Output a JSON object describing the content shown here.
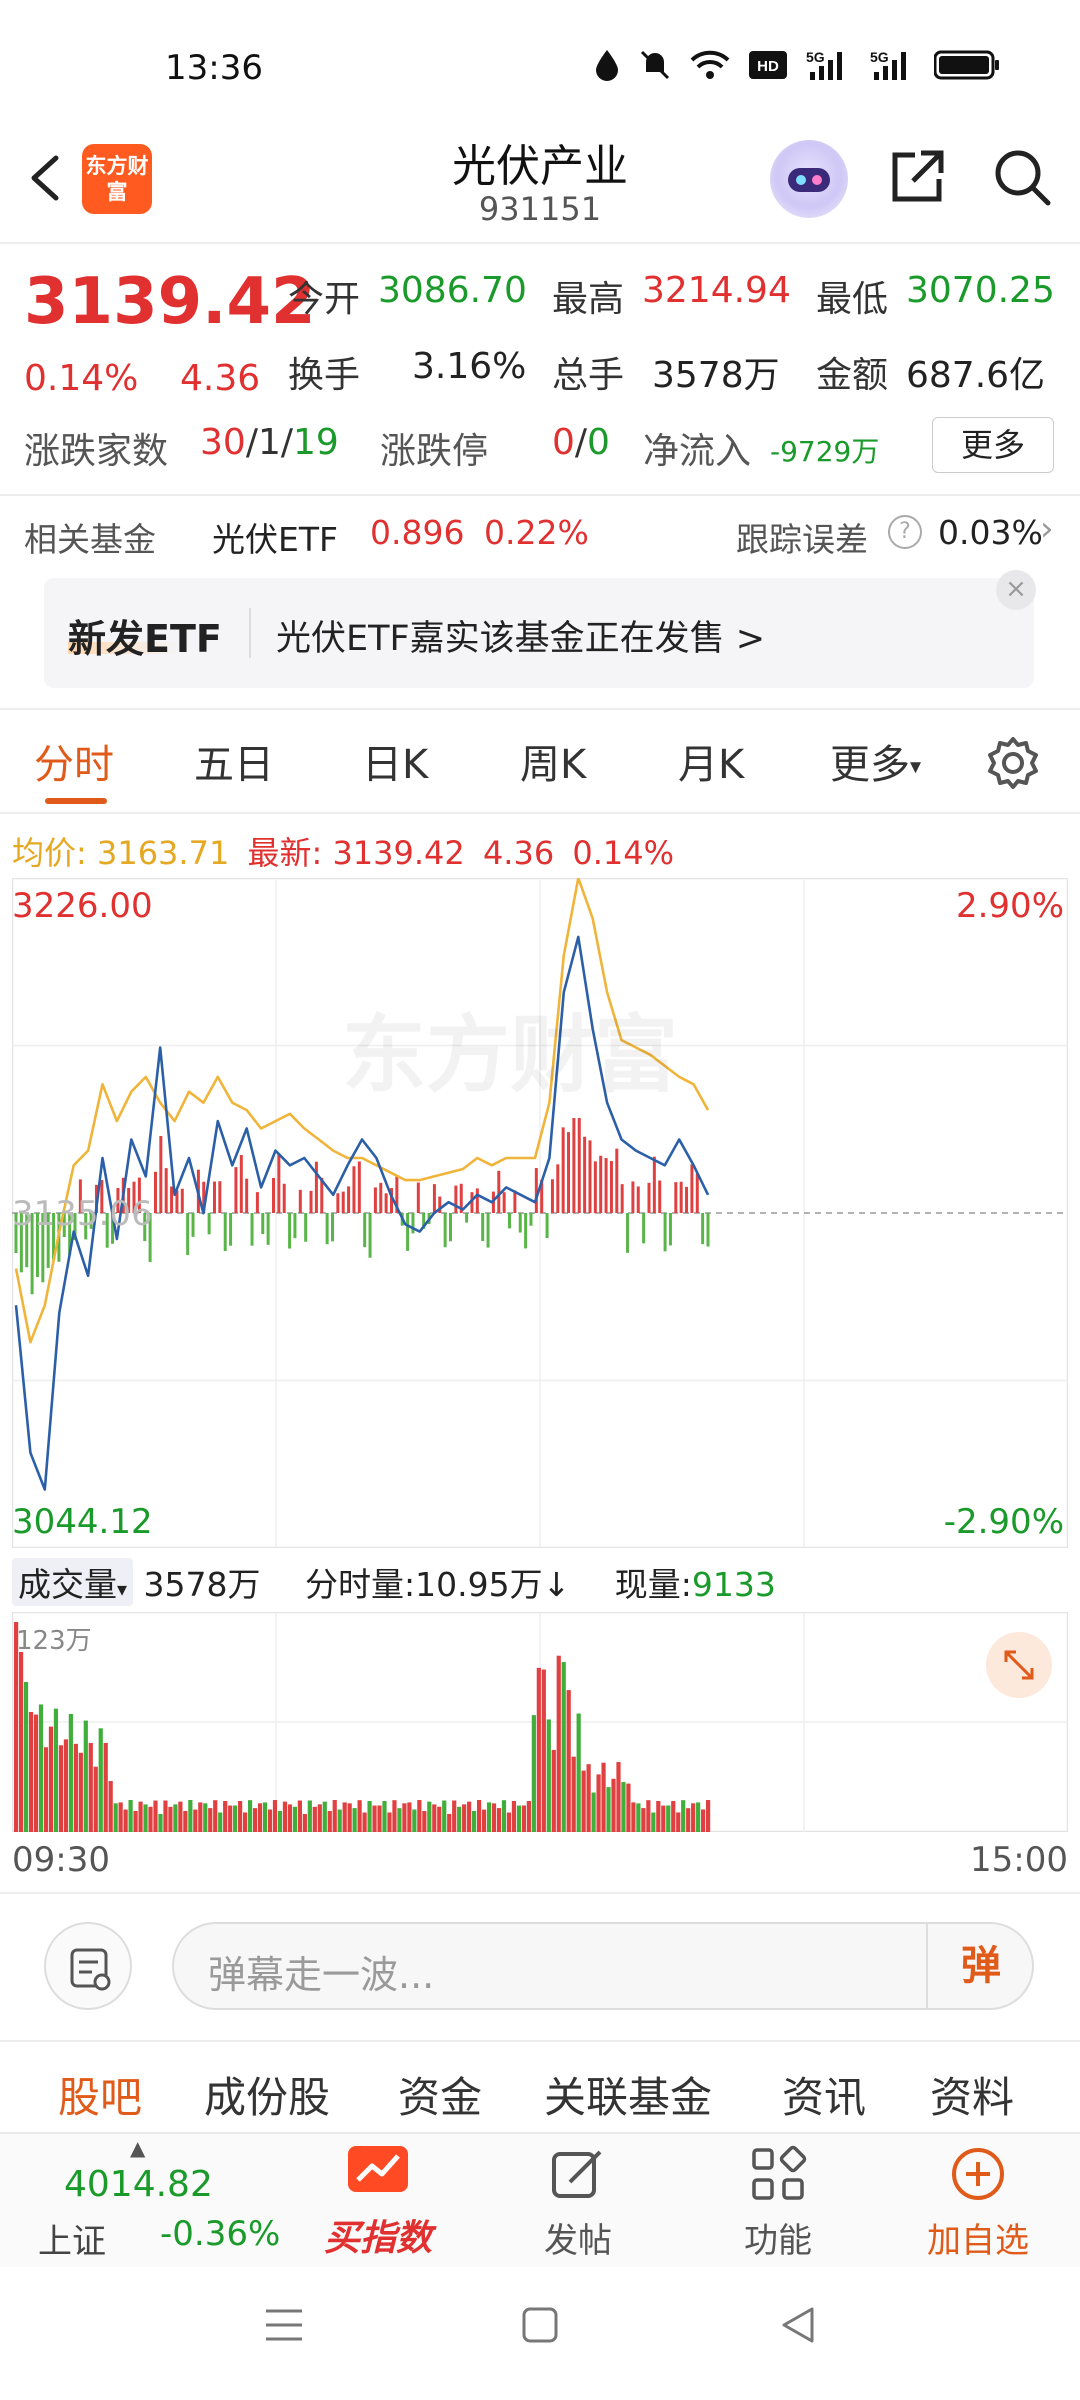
{
  "status_bar": {
    "time": "13:36",
    "net1": "5G",
    "net2": "5G"
  },
  "header": {
    "logo_text": "东方财富",
    "title": "光伏产业",
    "code": "931151"
  },
  "quote": {
    "price": "3139.42",
    "change_pct": "0.14%",
    "change": "4.36",
    "open_label": "今开",
    "open": "3086.70",
    "high_label": "最高",
    "high": "3214.94",
    "low_label": "最低",
    "low": "3070.25",
    "turnover_label": "换手",
    "turnover": "3.16%",
    "total_label": "总手",
    "total": "3578万",
    "amount_label": "金额",
    "amount": "687.6亿",
    "breadth_label": "涨跌家数",
    "breadth_up": "30",
    "breadth_flat": "/1/",
    "breadth_down": "19",
    "limit_label": "涨跌停",
    "limit_up": "0",
    "limit_sep": "/",
    "limit_down": "0",
    "netflow_label": "净流入",
    "netflow": "-9729万",
    "more": "更多"
  },
  "fund": {
    "label": "相关基金",
    "name": "光伏ETF",
    "price": "0.896",
    "pct": "0.22%",
    "track_label": "跟踪误差",
    "track_value": "0.03%"
  },
  "banner": {
    "tag": "新发ETF",
    "text": "光伏ETF嘉实该基金正在发售  >",
    "close": "×"
  },
  "chart_tabs": [
    {
      "label": "分时"
    },
    {
      "label": "五日"
    },
    {
      "label": "日K"
    },
    {
      "label": "周K"
    },
    {
      "label": "月K"
    },
    {
      "label": "更多"
    }
  ],
  "infoline": {
    "avg_label": "均价:",
    "avg": "3163.71",
    "latest_label": "最新:",
    "latest": "3139.42",
    "chg": "4.36",
    "pct": "0.14%"
  },
  "chart": {
    "ymax": "3226.00",
    "ymin": "3044.12",
    "pmax": "2.90%",
    "pmin": "-2.90%",
    "watermark": "东方财富",
    "mid_label": "3135.06"
  },
  "volume": {
    "sel_label": "成交量",
    "total": "3578万",
    "tick_label": "分时量:",
    "tick": "10.95万",
    "tick_arrow": "↓",
    "now_label": "现量:",
    "now": "9133",
    "max_label": "123万",
    "time_start": "09:30",
    "time_end": "15:00"
  },
  "chart_data": {
    "type": "line",
    "series": [
      {
        "name": "最新",
        "values": [
          3110,
          3070,
          3060,
          3108,
          3130,
          3118,
          3150,
          3128,
          3155,
          3145,
          3180,
          3140,
          3150,
          3135,
          3160,
          3148,
          3158,
          3142,
          3152,
          3148,
          3150,
          3145,
          3140,
          3148,
          3155,
          3150,
          3140,
          3132,
          3130,
          3135,
          3138,
          3136,
          3140,
          3138,
          3142,
          3140,
          3138,
          3150,
          3195,
          3210,
          3185,
          3165,
          3155,
          3152,
          3150,
          3148,
          3155,
          3148,
          3140
        ]
      },
      {
        "name": "均价",
        "values": [
          3120,
          3100,
          3110,
          3130,
          3148,
          3152,
          3170,
          3160,
          3168,
          3172,
          3165,
          3160,
          3168,
          3165,
          3172,
          3165,
          3163,
          3158,
          3160,
          3162,
          3158,
          3155,
          3152,
          3150,
          3150,
          3148,
          3146,
          3144,
          3144,
          3145,
          3146,
          3147,
          3150,
          3148,
          3150,
          3150,
          3150,
          3165,
          3205,
          3226,
          3215,
          3195,
          3182,
          3180,
          3178,
          3175,
          3172,
          3170,
          3163
        ]
      }
    ],
    "ylim": [
      3044.12,
      3226.0
    ]
  },
  "danmu": {
    "placeholder": "弹幕走一波...",
    "button": "弹"
  },
  "bottom_tabs": [
    {
      "label": "股吧"
    },
    {
      "label": "成份股"
    },
    {
      "label": "资金"
    },
    {
      "label": "关联基金"
    },
    {
      "label": "资讯"
    },
    {
      "label": "资料"
    }
  ],
  "bottom_bar": {
    "index_value": "4014.82",
    "index_name": "上证",
    "index_pct": "-0.36%",
    "buy_label": "买指数",
    "post_label": "发帖",
    "func_label": "功能",
    "add_label": "加自选"
  }
}
